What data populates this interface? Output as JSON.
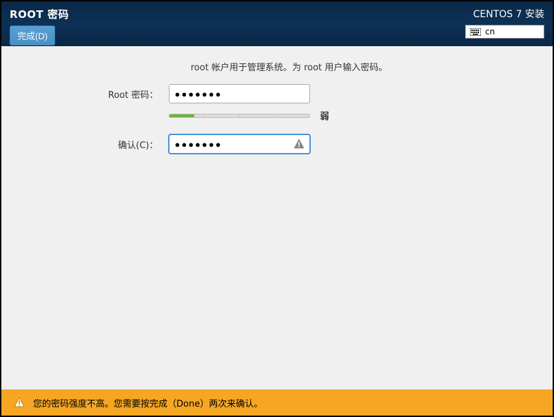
{
  "header": {
    "title": "ROOT 密码",
    "done_label": "完成(D)",
    "installer_title": "CENTOS 7 安装",
    "keyboard_layout": "cn"
  },
  "form": {
    "description": "root 帐户用于管理系统。为 root 用户输入密码。",
    "password_label": "Root 密码：",
    "password_value": "●●●●●●●",
    "confirm_label": "确认(C)：",
    "confirm_value": "●●●●●●●",
    "strength_label": "弱",
    "strength_percent": 18
  },
  "footer": {
    "warning_text": "您的密码强度不高。您需要按完成（Done）两次来确认。"
  }
}
